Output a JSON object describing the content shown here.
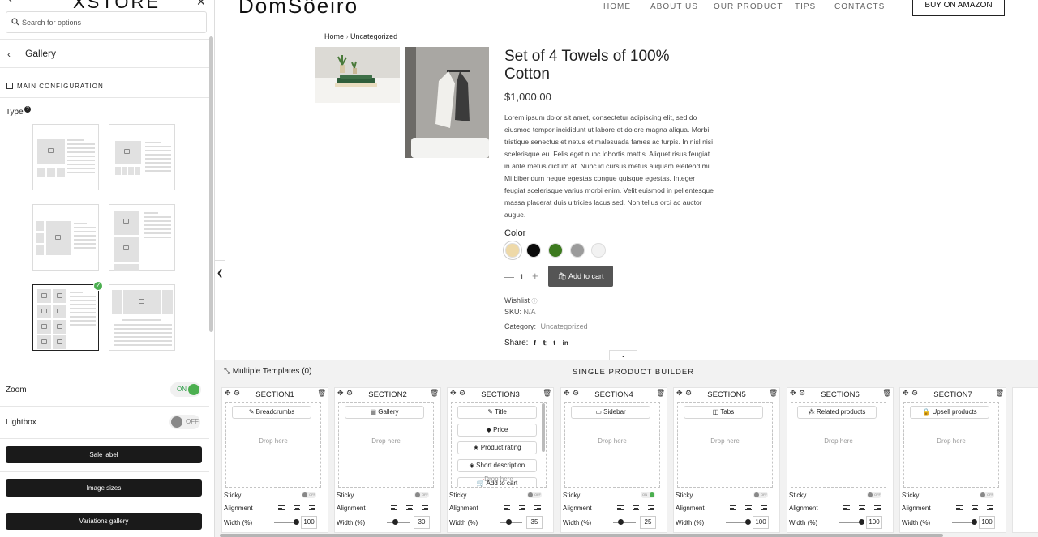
{
  "panel": {
    "logo": "XSTORE",
    "search_placeholder": "Search for options",
    "section_title": "Gallery",
    "main_config_label": "MAIN CONFIGURATION",
    "type_label": "Type",
    "type_help": "?",
    "zoom_label": "Zoom",
    "zoom_state": "ON",
    "lightbox_label": "Lightbox",
    "lightbox_state": "OFF",
    "buttons": [
      "Sale label",
      "Image sizes",
      "Variations gallery"
    ]
  },
  "site": {
    "logo": "DomSôeiro",
    "nav": [
      "HOME",
      "ABOUT US",
      "OUR PRODUCT",
      "TIPS",
      "CONTACTS"
    ],
    "amazon_button": "BUY ON AMAZON"
  },
  "product": {
    "breadcrumb_home": "Home",
    "breadcrumb_sep": "›",
    "breadcrumb_cat": "Uncategorized",
    "title": "Set of 4 Towels of 100% Cotton",
    "price": "$1,000.00",
    "description": "Lorem ipsum dolor sit amet, consectetur adipiscing elit, sed do eiusmod tempor incididunt ut labore et dolore magna aliqua. Morbi tristique senectus et netus et malesuada fames ac turpis. In nisl nisi scelerisque eu. Felis eget nunc lobortis mattis. Aliquet risus feugiat in ante metus dictum at. Nunc id cursus metus aliquam eleifend mi. Mi bibendum neque egestas congue quisque egestas. Integer feugiat scelerisque varius morbi enim. Velit euismod in pellentesque massa placerat duis ultricies lacus sed. Non tellus orci ac auctor augue.",
    "color_label": "Color",
    "swatches": [
      "#eed9a8",
      "#0a0a0a",
      "#3d7a1f",
      "#9b9b9b",
      "#f2f2f2"
    ],
    "quantity": "1",
    "add_to_cart": "Add to cart",
    "wishlist": "Wishlist",
    "sku_label": "SKU:",
    "sku_value": "N/A",
    "category_label": "Category:",
    "category_value": "Uncategorized",
    "share_label": "Share:"
  },
  "builder": {
    "multiple_templates": "Multiple Templates (0)",
    "title": "SINGLE PRODUCT BUILDER",
    "sticky_label": "Sticky",
    "alignment_label": "Alignment",
    "width_label": "Width (%)",
    "drop_here": "Drop here",
    "sections": [
      {
        "name": "SECTION1",
        "elements": [
          "Breadcrumbs"
        ],
        "sticky": "OFF",
        "width": "100"
      },
      {
        "name": "SECTION2",
        "elements": [
          "Gallery"
        ],
        "sticky": "OFF",
        "width": "30"
      },
      {
        "name": "SECTION3",
        "elements": [
          "Title",
          "Price",
          "Product rating",
          "Short description",
          "Add to cart"
        ],
        "sticky": "OFF",
        "width": "35"
      },
      {
        "name": "SECTION4",
        "elements": [
          "Sidebar"
        ],
        "sticky": "ON",
        "width": "25"
      },
      {
        "name": "SECTION5",
        "elements": [
          "Tabs"
        ],
        "sticky": "OFF",
        "width": "100"
      },
      {
        "name": "SECTION6",
        "elements": [
          "Related products"
        ],
        "sticky": "OFF",
        "width": "100"
      },
      {
        "name": "SECTION7",
        "elements": [
          "Upsell products"
        ],
        "sticky": "OFF",
        "width": "100"
      }
    ]
  }
}
